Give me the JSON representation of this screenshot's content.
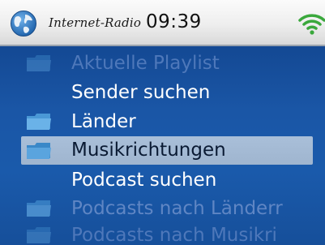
{
  "status_bar": {
    "app_title": "Internet-Radio",
    "clock": "09:39",
    "icons": [
      "globe-icon",
      "wifi-icon"
    ]
  },
  "menu": {
    "items": [
      {
        "label": "Aktuelle Playlist",
        "icon": "folder-icon",
        "state": "disabled"
      },
      {
        "label": "Sender suchen",
        "icon": "",
        "state": "normal"
      },
      {
        "label": "Länder",
        "icon": "folder-icon",
        "state": "normal"
      },
      {
        "label": "Musikrichtungen",
        "icon": "folder-icon",
        "state": "selected"
      },
      {
        "label": "Podcast suchen",
        "icon": "",
        "state": "normal"
      },
      {
        "label": "Podcasts nach Länderr",
        "icon": "folder-icon",
        "state": "dim"
      },
      {
        "label": "Podcasts nach Musikri",
        "icon": "folder-icon",
        "state": "disabled"
      }
    ]
  },
  "colors": {
    "background_blue": "#1a56a6",
    "selection": "#a9bfd9",
    "text_normal": "#ffffff",
    "text_dim": "#5f86c4",
    "folder_icon": "#4a98d6",
    "wifi_green": "#3aa83c"
  }
}
